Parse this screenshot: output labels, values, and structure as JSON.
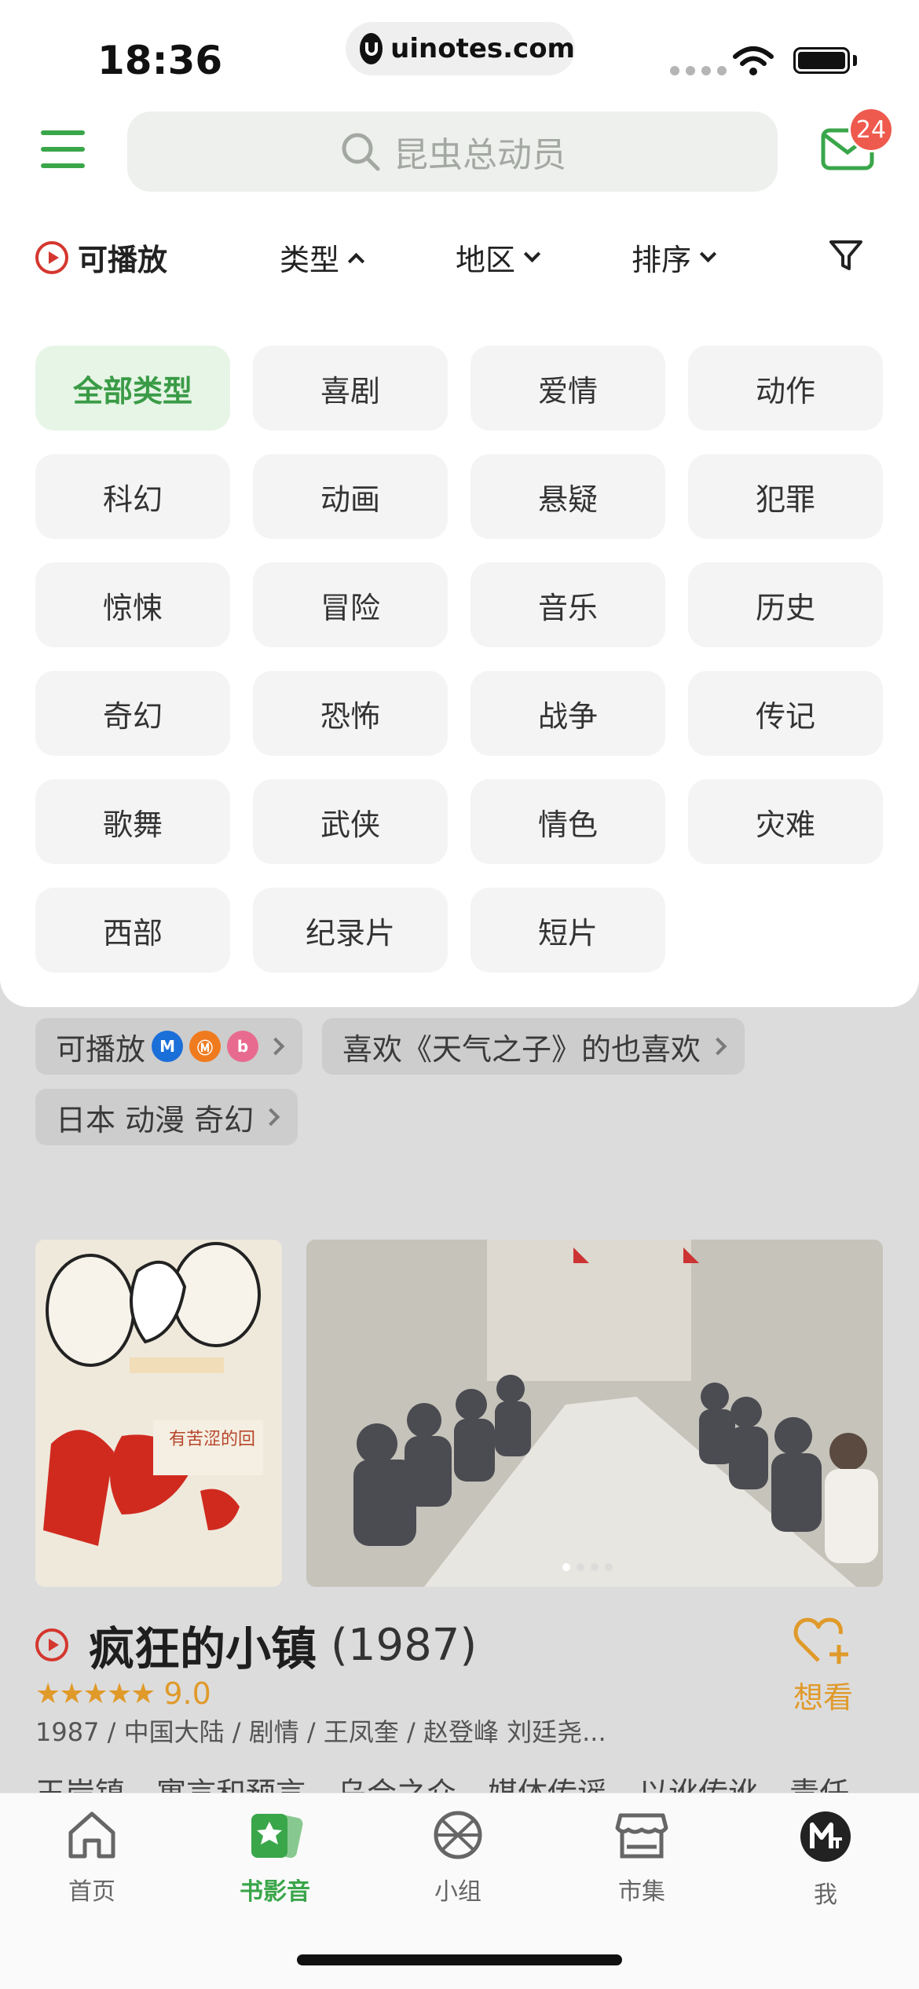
{
  "status_bar": {
    "time": "18:36",
    "url": "uinotes.com"
  },
  "header": {
    "search_placeholder": "昆虫总动员",
    "badge_count": "24"
  },
  "filters": {
    "playable": "可播放",
    "type": "类型",
    "region": "地区",
    "sort": "排序"
  },
  "genres": [
    {
      "label": "全部类型",
      "active": true
    },
    {
      "label": "喜剧"
    },
    {
      "label": "爱情"
    },
    {
      "label": "动作"
    },
    {
      "label": "科幻"
    },
    {
      "label": "动画"
    },
    {
      "label": "悬疑"
    },
    {
      "label": "犯罪"
    },
    {
      "label": "惊悚"
    },
    {
      "label": "冒险"
    },
    {
      "label": "音乐"
    },
    {
      "label": "历史"
    },
    {
      "label": "奇幻"
    },
    {
      "label": "恐怖"
    },
    {
      "label": "战争"
    },
    {
      "label": "传记"
    },
    {
      "label": "歌舞"
    },
    {
      "label": "武侠"
    },
    {
      "label": "情色"
    },
    {
      "label": "灾难"
    },
    {
      "label": "西部"
    },
    {
      "label": "纪录片"
    },
    {
      "label": "短片"
    }
  ],
  "quick_tags": {
    "playable": "可播放",
    "like": "喜欢《天气之子》的也喜欢",
    "japan": "日本 动漫 奇幻"
  },
  "movie": {
    "title": "疯狂的小镇",
    "year": "(1987)",
    "stars_text": "★★★★★",
    "rating": "9.0",
    "rating_fraction": 0.9,
    "meta": "1987 / 中国大陆 / 剧情 / 王凤奎 / 赵登峰 刘廷尧...",
    "tags": [
      "王岸镇",
      "寓言和预言",
      "乌合之众",
      "媒体传谣",
      "以讹传讹",
      "责任"
    ],
    "want_label": "想看",
    "poster_caption": "有苦涩的回",
    "carousel_pages": 4,
    "carousel_current": 1
  },
  "tabbar": [
    {
      "label": "首页",
      "icon": "home-icon"
    },
    {
      "label": "书影音",
      "icon": "book-movie-icon",
      "active": true
    },
    {
      "label": "小组",
      "icon": "group-icon"
    },
    {
      "label": "市集",
      "icon": "market-icon"
    },
    {
      "label": "我",
      "icon": "profile-icon"
    }
  ],
  "colors": {
    "accent": "#3aa64a",
    "badge": "#ef5a4e",
    "star": "#e09a2a",
    "play": "#d4372f"
  }
}
